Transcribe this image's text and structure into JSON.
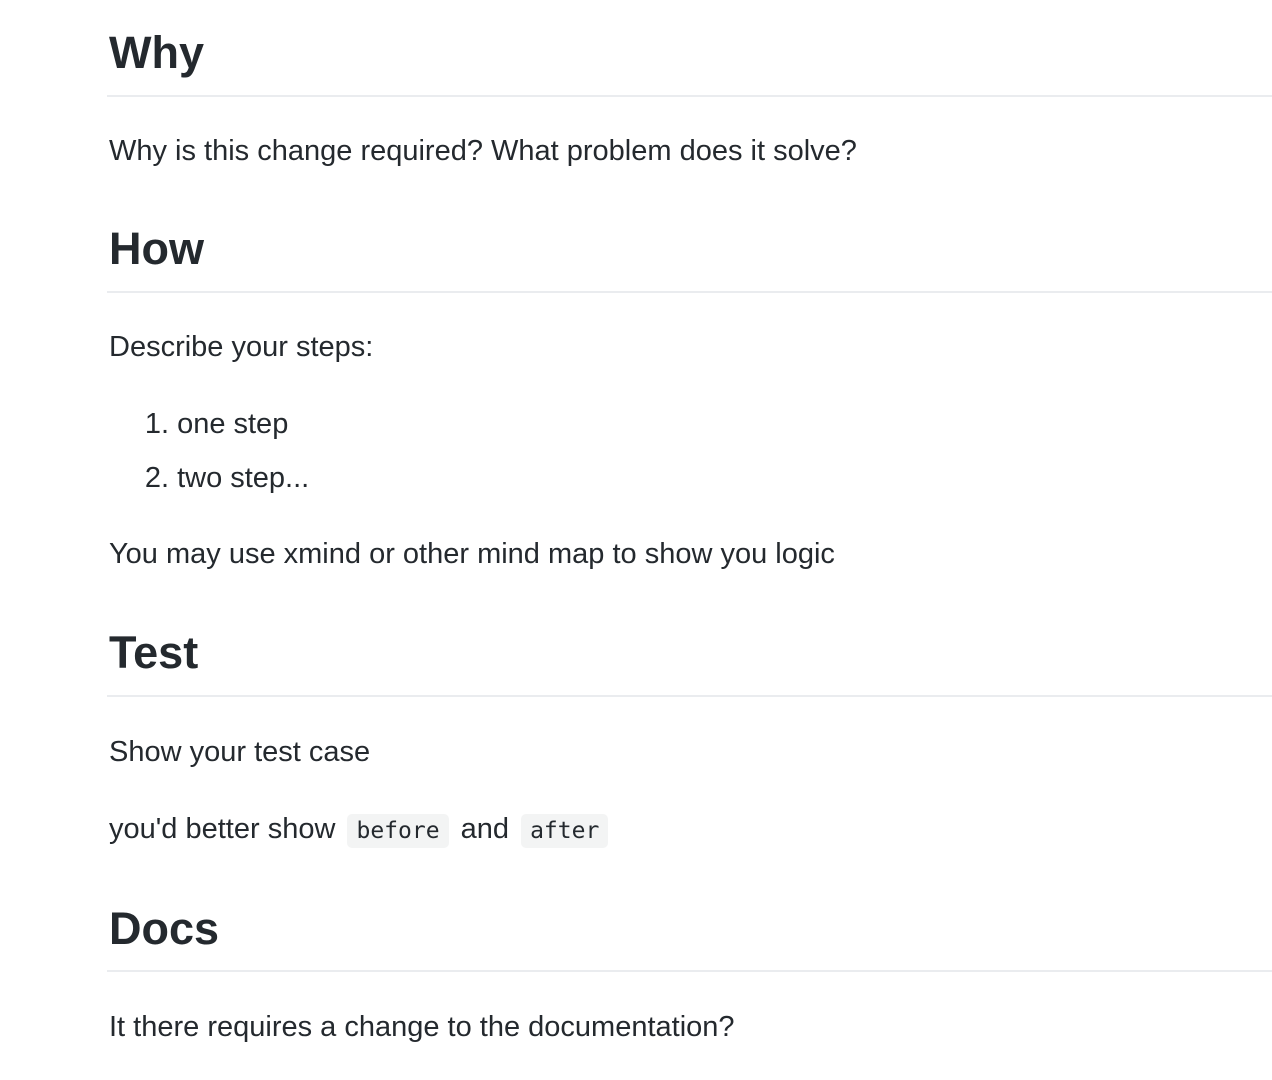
{
  "sections": {
    "why": {
      "heading": "Why",
      "paragraph": "Why is this change required? What problem does it solve?"
    },
    "how": {
      "heading": "How",
      "intro": "Describe your steps:",
      "steps": [
        {
          "number": "1.",
          "text": "one step"
        },
        {
          "number": "2.",
          "text": "two step..."
        }
      ],
      "note": "You may use xmind or other mind map to show you logic"
    },
    "test": {
      "heading": "Test",
      "paragraph": "Show your test case",
      "advice_prefix": "you'd better show",
      "code_before": "before",
      "advice_middle": "and",
      "code_after": "after"
    },
    "docs": {
      "heading": "Docs",
      "paragraph": "It there requires a change to the documentation?"
    }
  },
  "colors": {
    "text": "#24292e",
    "rule": "#eaecef",
    "code_background": "#f3f4f4"
  }
}
